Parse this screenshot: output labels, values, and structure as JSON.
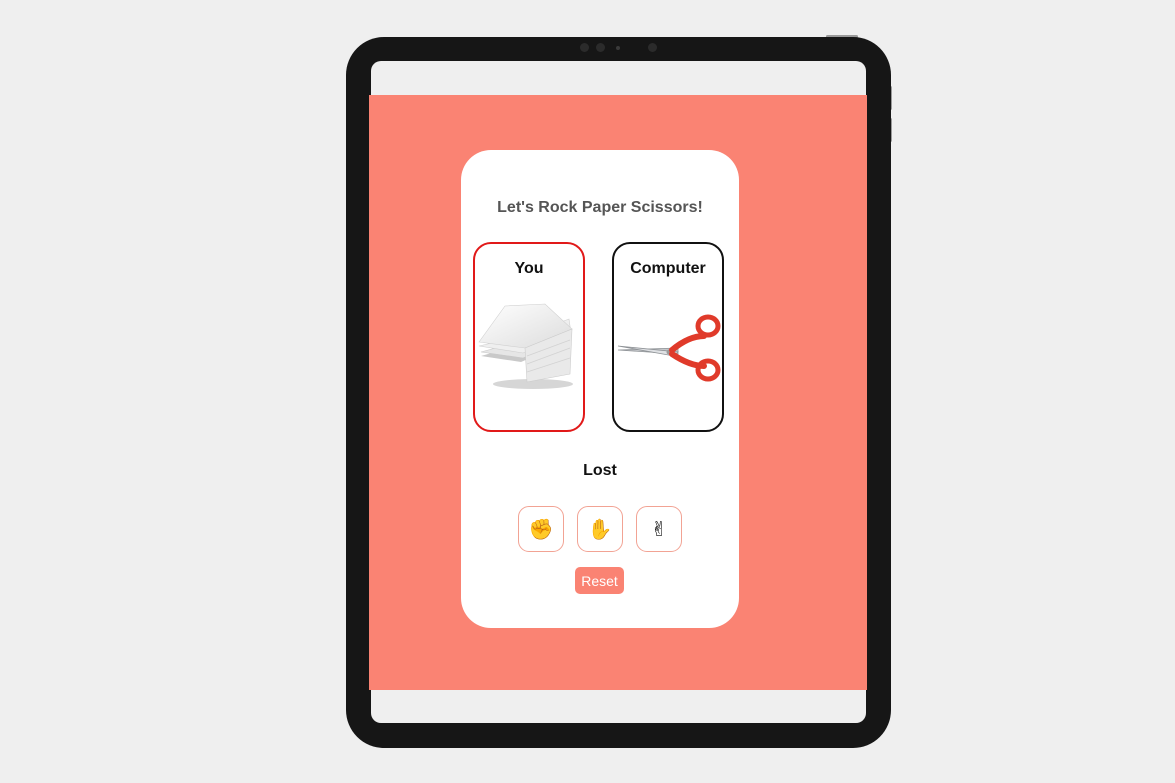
{
  "game": {
    "title": "Let's Rock Paper Scissors!",
    "result": "Lost",
    "reset_label": "Reset"
  },
  "players": {
    "you": {
      "label": "You",
      "choice_icon": "paper-stack-icon",
      "highlight_color": "#e11919"
    },
    "computer": {
      "label": "Computer",
      "choice_icon": "scissors-icon",
      "highlight_color": "#111111"
    }
  },
  "choices": [
    {
      "name": "rock",
      "icon": "fist-icon",
      "glyph": "✊"
    },
    {
      "name": "paper",
      "icon": "raised-hand-icon",
      "glyph": "✋"
    },
    {
      "name": "scissors",
      "icon": "victory-hand-icon",
      "glyph": "✌"
    }
  ],
  "colors": {
    "background": "#fa8373",
    "card": "#ffffff",
    "accent": "#fa8373"
  }
}
